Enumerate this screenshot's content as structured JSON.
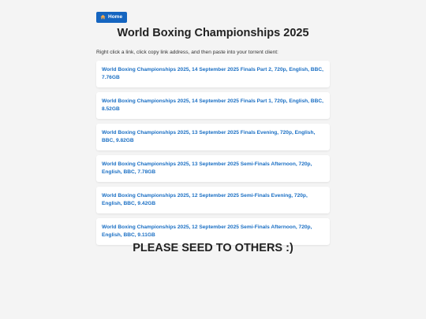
{
  "nav": {
    "home_label": "Home",
    "home_icon": "home-icon"
  },
  "page": {
    "title": "World Boxing Championships 2025",
    "instructions": "Right click a link, click copy link address, and then paste into your torrent client:",
    "footer": "PLEASE SEED TO OTHERS :)"
  },
  "links": [
    {
      "label": "World Boxing Championships 2025, 14 September 2025 Finals Part 2, 720p, English, BBC, 7.76GB"
    },
    {
      "label": "World Boxing Championships 2025, 14 September 2025 Finals Part 1, 720p, English, BBC, 8.52GB"
    },
    {
      "label": "World Boxing Championships 2025, 13 September 2025 Finals Evening, 720p, English, BBC, 9.82GB"
    },
    {
      "label": "World Boxing Championships 2025, 13 September 2025 Semi-Finals Afternoon, 720p, English, BBC, 7.78GB"
    },
    {
      "label": "World Boxing Championships 2025, 12 September 2025 Semi-Finals Evening, 720p, English, BBC, 9.42GB"
    },
    {
      "label": "World Boxing Championships 2025, 12 September 2025 Semi-Finals Afternoon, 720p, English, BBC, 9.11GB"
    }
  ],
  "colors": {
    "background": "#f4f4f4",
    "home_button": "#1565c0",
    "link": "#1a6fc4"
  }
}
